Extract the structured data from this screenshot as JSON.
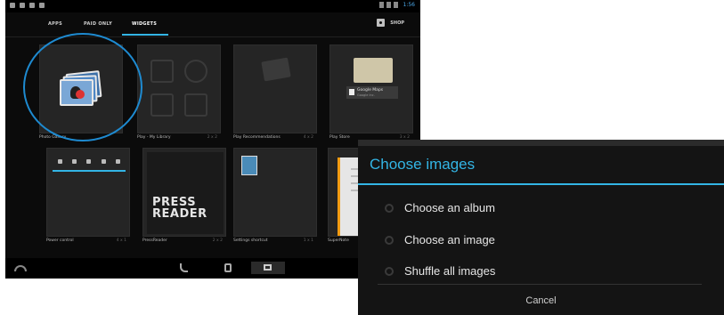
{
  "tabs": {
    "apps": "APPS",
    "paid_only": "PAID ONLY",
    "widgets": "WIDGETS",
    "shop": "SHOP"
  },
  "status": {
    "time": "1:56"
  },
  "widgets": [
    {
      "label": "Photo Gallery",
      "size": ""
    },
    {
      "label": "Play - My Library",
      "size": "2 x 2"
    },
    {
      "label": "Play Recommendations",
      "size": "4 x 2"
    },
    {
      "label": "Play Store",
      "size": "3 x 2"
    },
    {
      "label": "Power control",
      "size": "4 x 1"
    },
    {
      "label": "PressReader",
      "size": "2 x 2"
    },
    {
      "label": "Settings shortcut",
      "size": "1 x 1"
    },
    {
      "label": "SuperNote",
      "size": ""
    }
  ],
  "press_reader": {
    "line1": "PRESS",
    "line2": "READER"
  },
  "play_store_card": {
    "title": "Google Maps",
    "subtitle": "Google Inc."
  },
  "dialog": {
    "title": "Choose images",
    "options": [
      "Choose an album",
      "Choose an image",
      "Shuffle all images"
    ],
    "cancel": "Cancel"
  },
  "colors": {
    "accent": "#33b5e5",
    "highlight_circle": "#1e8ad0"
  }
}
